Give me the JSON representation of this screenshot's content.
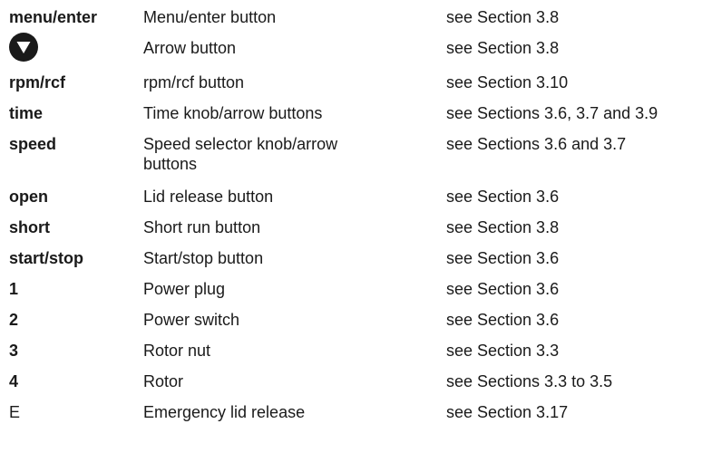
{
  "rows": [
    {
      "key": "menu/enter",
      "description": "Menu/enter button",
      "reference": "see Section 3.8"
    },
    {
      "icon": "arrow-down-circle-icon",
      "description": "Arrow button",
      "reference": "see Section 3.8"
    },
    {
      "key": "rpm/rcf",
      "description": "rpm/rcf button",
      "reference": "see Section 3.10"
    },
    {
      "key": "time",
      "description": "Time knob/arrow buttons",
      "reference": "see Sections 3.6, 3.7 and 3.9"
    },
    {
      "key": "speed",
      "description": "Speed selector knob/arrow buttons",
      "reference": "see Sections 3.6 and 3.7"
    },
    {
      "key": "open",
      "description": "Lid release button",
      "reference": "see Section 3.6"
    },
    {
      "key": "short",
      "description": "Short run button",
      "reference": "see Section 3.8"
    },
    {
      "key": "start/stop",
      "description": "Start/stop button",
      "reference": "see Section 3.6"
    },
    {
      "key": "1",
      "description": "Power plug",
      "reference": "see Section 3.6"
    },
    {
      "key": "2",
      "description": "Power switch",
      "reference": "see Section 3.6"
    },
    {
      "key": "3",
      "description": "Rotor nut",
      "reference": "see Section 3.3"
    },
    {
      "key": "4",
      "description": "Rotor",
      "reference": "see Sections 3.3 to 3.5"
    },
    {
      "key": "E",
      "description": "Emergency lid release",
      "reference": "see Section 3.17"
    }
  ],
  "colors": {
    "text": "#1a1a1a",
    "icon_fill": "#1a1a1a",
    "icon_glyph": "#ffffff"
  }
}
